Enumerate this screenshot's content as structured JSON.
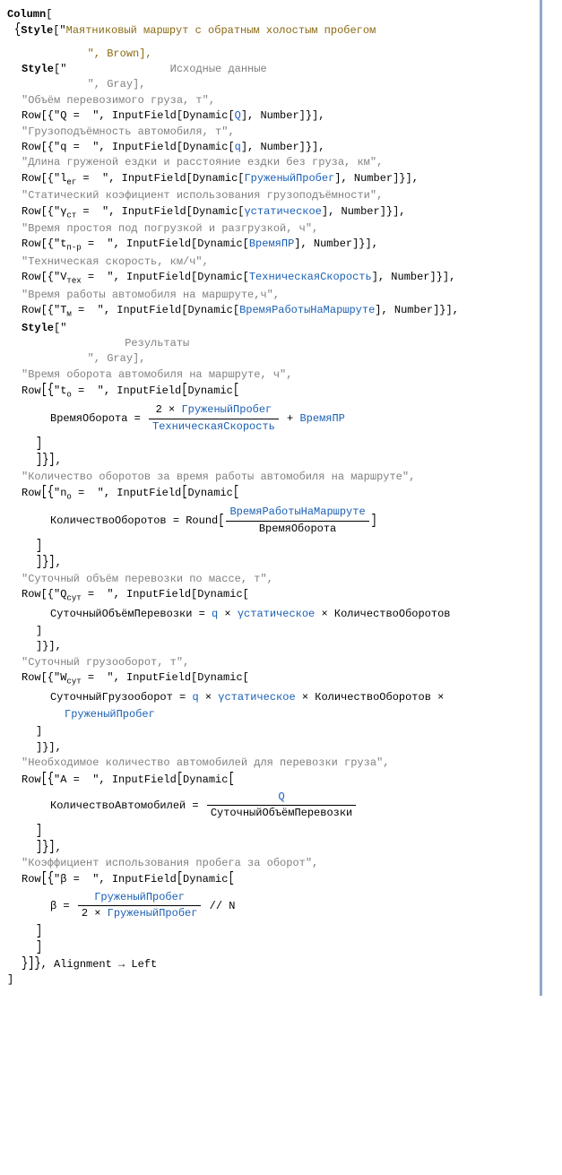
{
  "lang": "Wolfram Mathematica",
  "code": {
    "l1": "Column",
    "open_brace": "{",
    "style_fn": "Style",
    "title_text": "Маятниковый маршрут с обратным холостым пробегом",
    "title_cont": "        \", Brown],",
    "input_header": "                Исходные данные",
    "header_cont": "        \", Gray],",
    "line_volume": "\"Объём перевозимого груза, т\",",
    "row_Q": "Row[{\"Q =  \", InputField[Dynamic[",
    "row_Q_var": "Q",
    "row_Q_end": "], Number]}],",
    "line_capacity": "\"Грузоподъёмность автомобиля, т\",",
    "row_q": "Row[{\"q =  \", InputField[Dynamic[",
    "row_q_var": "q",
    "row_q_end": "], Number]}],",
    "line_length": "\"Длина груженой ездки и расстояние ездки без груза, км\",",
    "row_ler_pre": "Row[{\"l",
    "row_ler_sub": "ег",
    "row_ler_mid": " =  \", InputField[Dynamic[",
    "row_ler_var": "ГруженыйПробег",
    "row_ler_end": "], Number]}],",
    "line_static": "\"Статический коэфициент использования грузоподъёмности\",",
    "row_gst_pre": "Row[{\"γ",
    "row_gst_sub": "ст",
    "row_gst_mid": " =  \", InputField[Dynamic[",
    "row_gst_var": "γстатическое",
    "row_gst_end": "], Number]}],",
    "line_time_pr": "\"Время простоя под погрузкой и разгрузкой, ч\",",
    "row_tpr_pre": "Row[{\"t",
    "row_tpr_sub": "п-р",
    "row_tpr_mid": " =  \", InputField[Dynamic[",
    "row_tpr_var": "ВремяПР",
    "row_tpr_end": "], Number]}],",
    "line_speed": "\"Техническая скорость, км/ч\",",
    "row_v_pre": "Row[{\"V",
    "row_v_sub": "тех",
    "row_v_mid": " =  \", InputField[Dynamic[",
    "row_v_var": "ТехническаяСкорость",
    "row_v_end": "], Number]}],",
    "line_work": "\"Время работы автомобиля на маршруте,ч\",",
    "row_tm_pre": "Row[{\"T",
    "row_tm_sub": "м",
    "row_tm_mid": " =  \", InputField[Dynamic[",
    "row_tm_var": "ВремяРаботыНаМаршруте",
    "row_tm_end": "], Number]}],",
    "results_header": "                Результаты",
    "line_turnaround": "\"Время оборота автомобиля на маршруте, ч\",",
    "row_to_pre": "Row",
    "row_to_label_pre": "\"t",
    "row_to_sub": "о",
    "row_to_label_mid": " =  \", InputField",
    "row_to_dyn": "Dynamic",
    "calc_vo_assign": "ВремяОборота = ",
    "calc_vo_num_pre": "2 × ",
    "calc_vo_num_var": "ГруженыйПробег",
    "calc_vo_den": "ТехническаяСкорость",
    "calc_vo_plus": " + ",
    "calc_vo_add": "ВремяПР",
    "line_count_turns": "\"Количество оборотов за время работы автомобиля на маршруте\",",
    "row_no_label_pre": "\"n",
    "row_no_sub": "о",
    "calc_ko_assign": "КоличествоОборотов = Round",
    "calc_ko_num": "ВремяРаботыНаМаршруте",
    "calc_ko_den": "ВремяОборота",
    "line_daily_vol": "\"Суточный объём перевозки по массе, т\",",
    "row_qsut_pre": "Row[{\"Q",
    "row_qsut_sub": "сут",
    "row_qsut_mid": " =  \", InputField[Dynamic[",
    "calc_sop_assign": "СуточныйОбъёмПеревозки = ",
    "calc_sop_q": "q",
    "calc_sop_times1": " × ",
    "calc_sop_gst": "γстатическое",
    "calc_sop_times2": " × КоличествоОборотов",
    "line_daily_turnover": "\"Суточный грузооборот, т\",",
    "row_wsut_pre": "Row[{\"W",
    "row_wsut_sub": "сут",
    "calc_sg_assign": "СуточныйГрузооборот = ",
    "calc_sg_part2": " × КоличествоОборотов ×",
    "calc_sg_part3": "ГруженыйПробег",
    "line_needed": "\"Необходимое количество автомобилей для перевозки груза\",",
    "row_A_label": "\"A =  \", InputField",
    "calc_ka_assign": "КоличествоАвтомобилей = ",
    "calc_ka_num": "Q",
    "calc_ka_den": "СуточныйОбъёмПеревозки",
    "line_coef": "\"Коэффициент использования пробега за оборот\",",
    "row_beta_label": "\"β =  \", InputField",
    "calc_b_assign": "β = ",
    "calc_b_num": "ГруженыйПробег",
    "calc_b_den_pre": "2 × ",
    "calc_b_den_var": "ГруженыйПробег",
    "calc_b_tail": " // N",
    "close_align": ", Alignment → Left",
    "close_bracket": "]"
  }
}
